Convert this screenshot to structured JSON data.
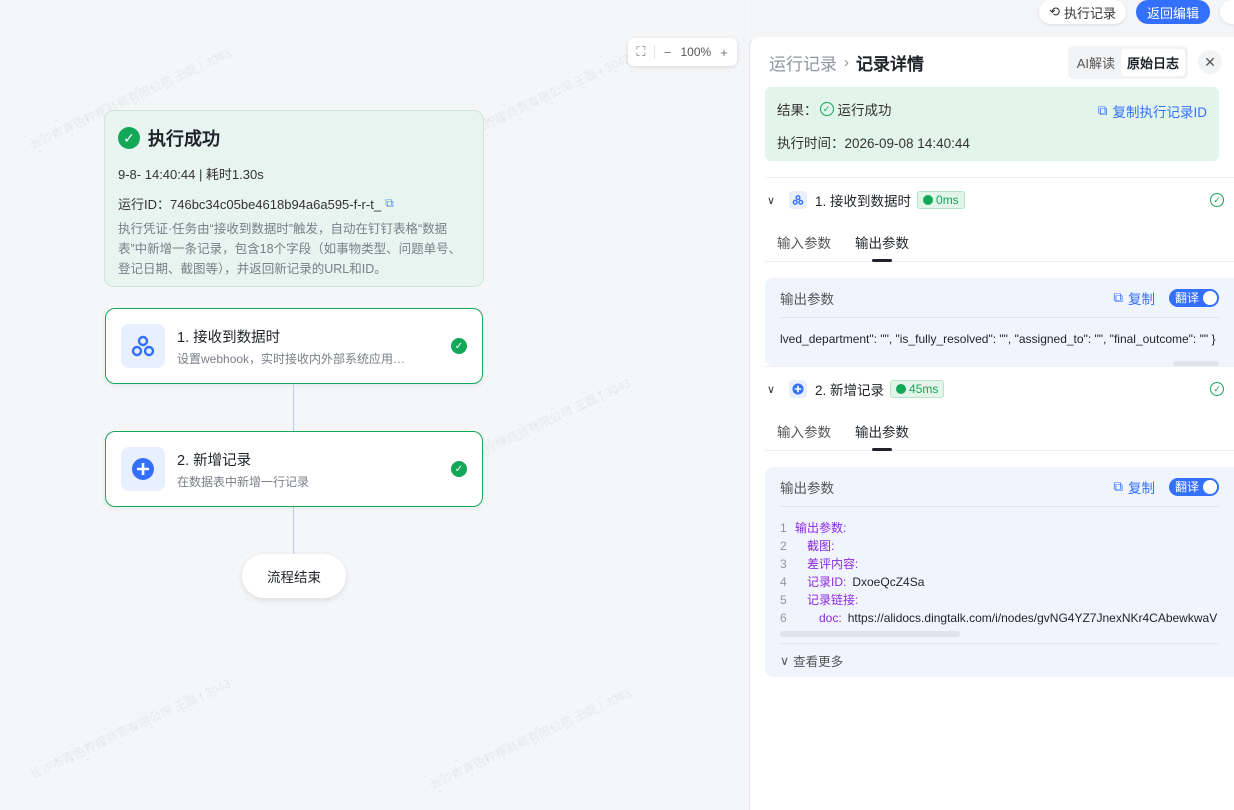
{
  "topbar": {
    "history_label": "执行记录",
    "return_label": "返回编辑"
  },
  "zoom": {
    "level": "100%"
  },
  "summary": {
    "title": "执行成功",
    "meta": "9-8- 14:40:44 | 耗时1.30s",
    "run_id": "运行ID：746bc34c05be4618b94a6a595-f-r-t_",
    "description": "执行凭证·任务由“接收到数据时”触发，自动在钉钉表格“数据表”中新增一条记录，包含18个字段（如事物类型、问题单号、登记日期、截图等），并返回新记录的URL和ID。"
  },
  "nodes": [
    {
      "title": "1. 接收到数据时",
      "subtitle": "设置webhook，实时接收内外部系统应用的数据"
    },
    {
      "title": "2. 新增记录",
      "subtitle": "在数据表中新增一行记录"
    }
  ],
  "end_node": {
    "label": "流程结束"
  },
  "panel": {
    "breadcrumb_parent": "运行记录",
    "breadcrumb_current": "记录详情",
    "seg_ai": "AI解读",
    "seg_raw": "原始日志",
    "result_label": "结果：",
    "result_value": "运行成功",
    "exec_time": "执行时间：2026-09-08 14:40:44",
    "copy_id_label": "复制执行记录ID",
    "steps": [
      {
        "title": "1. 接收到数据时",
        "duration": "0ms",
        "tab_input": "输入参数",
        "tab_output": "输出参数",
        "out_label": "输出参数",
        "copy_label": "复制",
        "translate_label": "翻译",
        "json_line": "lved_department\": \"\", \"is_fully_resolved\": \"\", \"assigned_to\": \"\", \"final_outcome\": \"\" }"
      },
      {
        "title": "2. 新增记录",
        "duration": "45ms",
        "tab_input": "输入参数",
        "tab_output": "输出参数",
        "out_label": "输出参数",
        "copy_label": "复制",
        "translate_label": "翻译",
        "code_lines": [
          {
            "num": "1",
            "key": "输出参数:",
            "value": ""
          },
          {
            "num": "2",
            "key": "截图:",
            "value": ""
          },
          {
            "num": "3",
            "key": "差评内容:",
            "value": ""
          },
          {
            "num": "4",
            "key": "记录ID:",
            "value": "DxoeQcZ4Sa"
          },
          {
            "num": "5",
            "key": "记录链接:",
            "value": ""
          },
          {
            "num": "6",
            "key": "doc:",
            "value": "https://alidocs.dingtalk.com/i/nodes/gvNG4YZ7JnexNKr4CAbewkwaV"
          }
        ],
        "more_label": "查看更多"
      }
    ]
  },
  "colors": {
    "accent": "#3370ff",
    "success": "#13a858"
  }
}
